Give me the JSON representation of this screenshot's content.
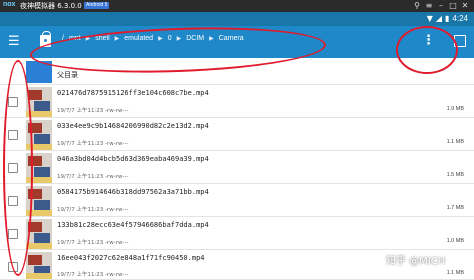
{
  "window": {
    "app_logo": "nox",
    "title": "夜神模拟器 6.3.0.0",
    "android_badge": "Android 5"
  },
  "status_bar": {
    "time": "4:24"
  },
  "app_bar": {
    "breadcrumbs": [
      "/",
      "mnt",
      "shell",
      "emulated",
      "0",
      "DCIM",
      "Camera"
    ]
  },
  "list": {
    "parent_label": "父目录",
    "files": [
      {
        "name": "021476d7875915126ff3e104c608c7be.mp4",
        "meta": "19/7/7 上午11:23  -rw-rw---",
        "size": "1.9 MB"
      },
      {
        "name": "033e4ee9c9b14684206990d82c2e13d2.mp4",
        "meta": "19/7/7 上午11:23  -rw-rw---",
        "size": "1.1 MB"
      },
      {
        "name": "046a3bd04d4bcb5d63d369eaba469a39.mp4",
        "meta": "19/7/7 上午11:23  -rw-rw---",
        "size": "1.5 MB"
      },
      {
        "name": "0584175b914646b318dd97562a3a71bb.mp4",
        "meta": "19/7/7 上午11:23  -rw-rw---",
        "size": "1.7 MB"
      },
      {
        "name": "133b81c28ecc63e4f57946686baf7dda.mp4",
        "meta": "19/7/7 上午11:23  -rw-rw---",
        "size": "1.0 MB"
      },
      {
        "name": "16ee043f2027c62e848a1f71fc90450.mp4",
        "meta": "19/7/7 上午11:23  -rw-rw---",
        "size": "1.1 MB"
      }
    ]
  },
  "watermark": "知乎 @MICH",
  "colors": {
    "app_bar": "#1f88c9",
    "status_bar": "#1976a8",
    "folder": "#2b7fd4",
    "annotation": "#e01b2c"
  }
}
